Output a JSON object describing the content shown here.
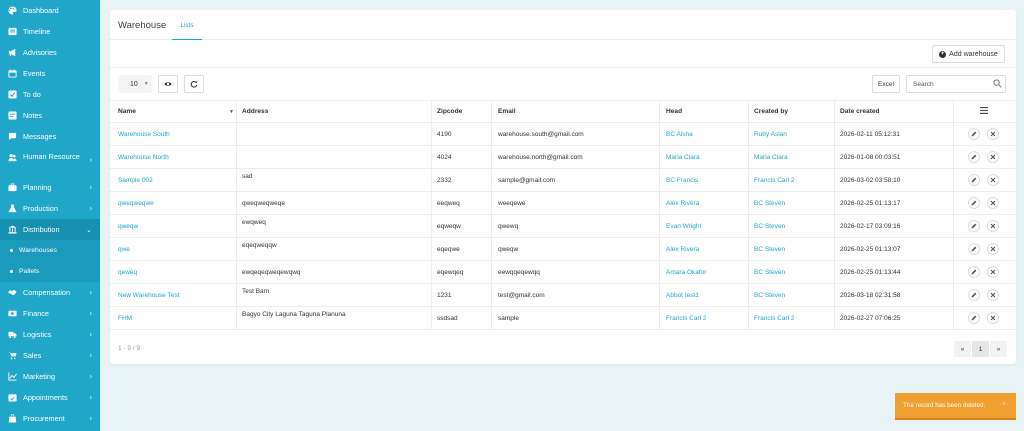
{
  "sidebar": {
    "items": [
      {
        "label": "Dashboard",
        "icon": "palette-icon",
        "chevron": false
      },
      {
        "label": "Timeline",
        "icon": "timeline-icon",
        "chevron": false
      },
      {
        "label": "Advisories",
        "icon": "megaphone-icon",
        "chevron": false
      },
      {
        "label": "Events",
        "icon": "calendar-icon",
        "chevron": false
      },
      {
        "label": "To do",
        "icon": "checkbox-icon",
        "chevron": false
      },
      {
        "label": "Notes",
        "icon": "note-icon",
        "chevron": false
      },
      {
        "label": "Messages",
        "icon": "message-icon",
        "chevron": false
      },
      {
        "label": "Human Resource",
        "icon": "users-icon",
        "chevron": true
      },
      {
        "label": "Planning",
        "icon": "briefcase-icon",
        "chevron": true
      },
      {
        "label": "Production",
        "icon": "flask-icon",
        "chevron": true
      },
      {
        "label": "Distribution",
        "icon": "bank-icon",
        "chevron": true
      },
      {
        "label": "Compensation",
        "icon": "handshake-icon",
        "chevron": true
      },
      {
        "label": "Finance",
        "icon": "money-icon",
        "chevron": true
      },
      {
        "label": "Logistics",
        "icon": "truck-icon",
        "chevron": true
      },
      {
        "label": "Sales",
        "icon": "cart-icon",
        "chevron": true
      },
      {
        "label": "Marketing",
        "icon": "chart-icon",
        "chevron": true
      },
      {
        "label": "Appointments",
        "icon": "calendar-check-icon",
        "chevron": true
      },
      {
        "label": "Procurement",
        "icon": "bag-icon",
        "chevron": true
      }
    ],
    "distribution_sub": [
      {
        "label": "Warehouses"
      },
      {
        "label": "Pallets"
      }
    ],
    "chevron_right": "›",
    "chevron_down": "⌄"
  },
  "page": {
    "title": "Warehouse",
    "tab_lists": "Lists",
    "add_button": "Add warehouse",
    "page_size": "10",
    "excel": "Excel",
    "search_placeholder": "Search",
    "pagination_info": "1 - 9 / 9",
    "prev": "«",
    "current_page": "1",
    "next": "»"
  },
  "table": {
    "headers": {
      "name": "Name",
      "address": "Address",
      "zipcode": "Zipcode",
      "email": "Email",
      "head": "Head",
      "created_by": "Created by",
      "date_created": "Date created"
    },
    "rows": [
      {
        "name": "Warehouse South",
        "address": "",
        "zipcode": "4190",
        "email": "warehouse.south@gmail.com",
        "head": "BC Aisha",
        "created_by": "Ruby Aslan",
        "date_created": "2026-02-11 05:12:31"
      },
      {
        "name": "Warehouse North",
        "address": "",
        "zipcode": "4024",
        "email": "warehouse.north@gmail.com",
        "head": "Maria Clara",
        "created_by": "Maria Clara",
        "date_created": "2026-01-08 00:03:51"
      },
      {
        "name": "Sample 002",
        "address": "sad",
        "zipcode": "2332",
        "email": "sample@gmail.com",
        "head": "BC Francis",
        "created_by": "Francis Carl 2",
        "date_created": "2026-03-02 03:58:10"
      },
      {
        "name": "qweqweqwe",
        "address": "qweqweqweqe",
        "zipcode": "eeqweq",
        "email": "weeqewe",
        "head": "Alex Rivera",
        "created_by": "BC Steven",
        "date_created": "2026-02-25 01:13:17"
      },
      {
        "name": "qweqw",
        "address": "ewqweq",
        "zipcode": "eqweqw",
        "email": "qwewq",
        "head": "Evan Wright",
        "created_by": "BC Steven",
        "date_created": "2026-02-17 03:09:16"
      },
      {
        "name": "qwe",
        "address": "eqeqweqqw",
        "zipcode": "eqeqwe",
        "email": "qweqw",
        "head": "Alex Rivera",
        "created_by": "BC Steven",
        "date_created": "2026-02-25 01:13:07"
      },
      {
        "name": "qeweq",
        "address": "ewqeqeqweqewqwq",
        "zipcode": "eqewqeq",
        "email": "eewqqeqewqq",
        "head": "Amara Okafor",
        "created_by": "BC Steven",
        "date_created": "2026-02-25 01:13:44"
      },
      {
        "name": "New Warehouse Test",
        "address": "Test Bam",
        "zipcode": "1231",
        "email": "test@gmail.com",
        "head": "Abbot test1",
        "created_by": "BC Steven",
        "date_created": "2026-03-18 02:31:58"
      },
      {
        "name": "FHM",
        "address": "Bagyo City Laguna Taguna Planuna",
        "zipcode": "ssdsad",
        "email": "sample",
        "head": "Francis Carl 2",
        "created_by": "Francis Carl 2",
        "date_created": "2026-02-27 07:06:25"
      }
    ]
  },
  "toast": {
    "message": "The record has been deleted.",
    "close": "×"
  },
  "colors": {
    "sidebar": "#1fa6c9",
    "sidebar_active": "#1590b0",
    "link": "#1fa6c9",
    "toast": "#f0a030"
  }
}
